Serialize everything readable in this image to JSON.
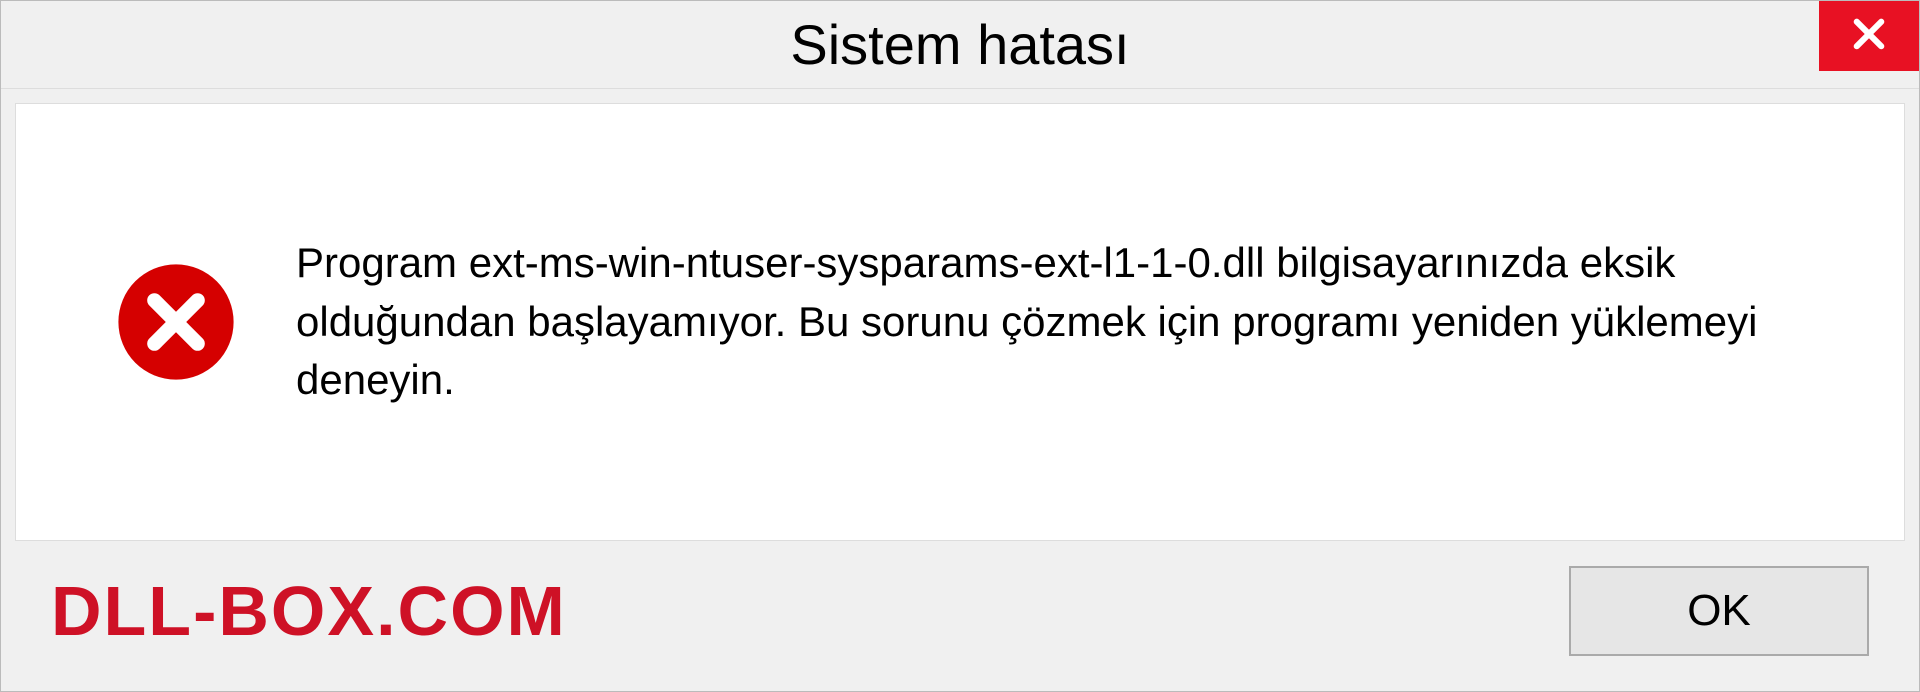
{
  "dialog": {
    "title": "Sistem hatası",
    "message": "Program ext-ms-win-ntuser-sysparams-ext-l1-1-0.dll bilgisayarınızda eksik olduğundan başlayamıyor. Bu sorunu çözmek için programı yeniden yüklemeyi deneyin.",
    "ok_label": "OK"
  },
  "watermark": "DLL-BOX.COM"
}
